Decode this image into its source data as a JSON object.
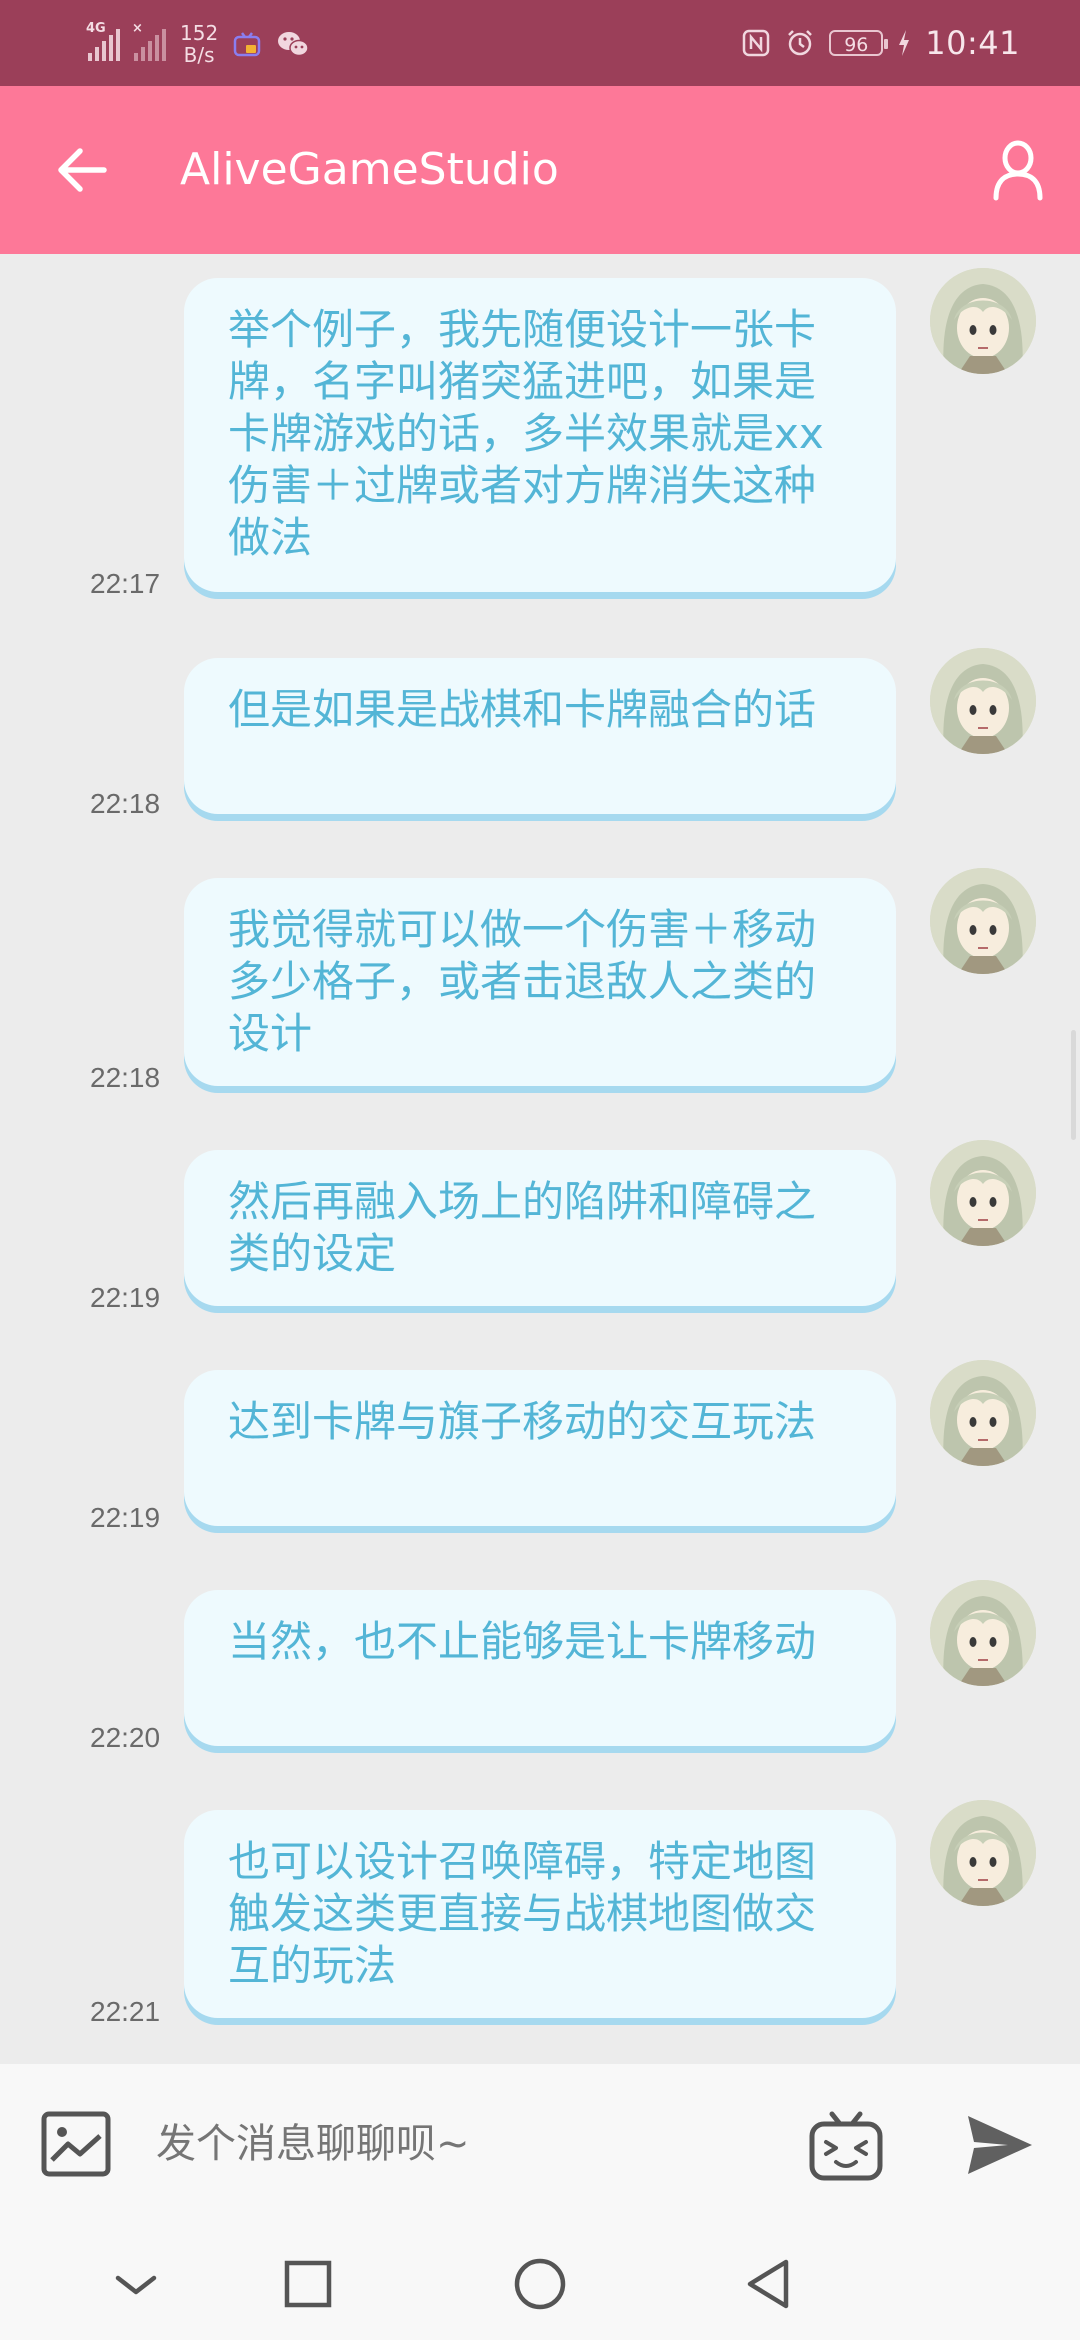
{
  "status_bar": {
    "signal1_label": "4G",
    "signal2_label": "×",
    "net_speed_value": "152",
    "net_speed_unit": "B/s",
    "battery": "96",
    "time": "10:41"
  },
  "app_bar": {
    "title": "AliveGameStudio"
  },
  "messages": [
    {
      "text": "举个例子，我先随便设计一张卡牌，名字叫猪突猛进吧，如果是卡牌游戏的话，多半效果就是xx伤害＋过牌或者对方牌消失这种做法",
      "time": "22:17"
    },
    {
      "text": "但是如果是战棋和卡牌融合的话",
      "time": "22:18"
    },
    {
      "text": "我觉得就可以做一个伤害＋移动多少格子，或者击退敌人之类的设计",
      "time": "22:18"
    },
    {
      "text": "然后再融入场上的陷阱和障碍之类的设定",
      "time": "22:19"
    },
    {
      "text": "达到卡牌与旗子移动的交互玩法",
      "time": "22:19"
    },
    {
      "text": "当然，也不止能够是让卡牌移动",
      "time": "22:20"
    },
    {
      "text": "也可以设计召唤障碍，特定地图触发这类更直接与战棋地图做交互的玩法",
      "time": "22:21"
    }
  ],
  "input_bar": {
    "placeholder": "发个消息聊聊呗~"
  },
  "icons": {
    "back": "arrow-left-icon",
    "profile": "person-icon",
    "image": "image-icon",
    "emoji": "tv-emoji-icon",
    "send": "send-icon",
    "nav_down": "chevron-down-icon",
    "nav_recent": "square-icon",
    "nav_home": "circle-icon",
    "nav_back": "triangle-back-icon"
  },
  "colors": {
    "status_bar": "#9b3f59",
    "app_bar": "#fd7898",
    "bubble_bg": "#eefafe",
    "bubble_text": "#53b5d6",
    "chat_bg": "#ececec"
  }
}
